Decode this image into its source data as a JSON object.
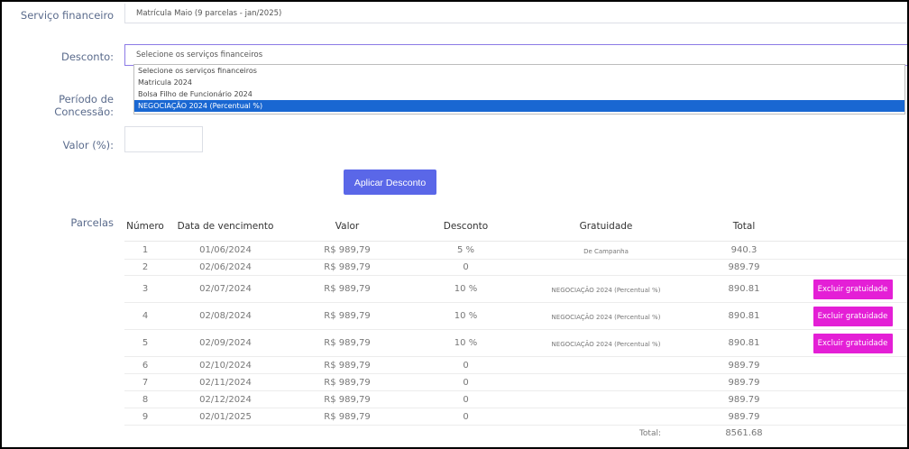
{
  "form": {
    "servico_label": "Serviço financeiro",
    "servico_value": "Matrícula Maio (9 parcelas - jan/2025)",
    "desconto_label": "Desconto:",
    "desconto_value": "Selecione os serviços financeiros",
    "periodo_label": "Período de Concessão:",
    "valor_label": "Valor (%):",
    "valor_value": "",
    "apply_label": "Aplicar Desconto"
  },
  "dropdown": {
    "options": [
      "Selecione os serviços financeiros",
      "Matricula 2024",
      "Bolsa Filho de Funcionário 2024",
      "NEGOCIAÇÃO 2024 (Percentual %)"
    ],
    "selected_index": 3
  },
  "parcelas": {
    "section_label": "Parcelas",
    "headers": [
      "Número",
      "Data de vencimento",
      "Valor",
      "Desconto",
      "Gratuidade",
      "Total"
    ],
    "rows": [
      {
        "numero": "1",
        "data": "01/06/2024",
        "valor": "R$ 989,79",
        "desconto": "5 %",
        "gratuidade": "De Campanha",
        "total": "940.3",
        "action": ""
      },
      {
        "numero": "2",
        "data": "02/06/2024",
        "valor": "R$ 989,79",
        "desconto": "0",
        "gratuidade": "",
        "total": "989.79",
        "action": ""
      },
      {
        "numero": "3",
        "data": "02/07/2024",
        "valor": "R$ 989,79",
        "desconto": "10 %",
        "gratuidade": "NEGOCIAÇÃO 2024 (Percentual %)",
        "total": "890.81",
        "action": "Excluir gratuidade"
      },
      {
        "numero": "4",
        "data": "02/08/2024",
        "valor": "R$ 989,79",
        "desconto": "10 %",
        "gratuidade": "NEGOCIAÇÃO 2024 (Percentual %)",
        "total": "890.81",
        "action": "Excluir gratuidade"
      },
      {
        "numero": "5",
        "data": "02/09/2024",
        "valor": "R$ 989,79",
        "desconto": "10 %",
        "gratuidade": "NEGOCIAÇÃO 2024 (Percentual %)",
        "total": "890.81",
        "action": "Excluir gratuidade"
      },
      {
        "numero": "6",
        "data": "02/10/2024",
        "valor": "R$ 989,79",
        "desconto": "0",
        "gratuidade": "",
        "total": "989.79",
        "action": ""
      },
      {
        "numero": "7",
        "data": "02/11/2024",
        "valor": "R$ 989,79",
        "desconto": "0",
        "gratuidade": "",
        "total": "989.79",
        "action": ""
      },
      {
        "numero": "8",
        "data": "02/12/2024",
        "valor": "R$ 989,79",
        "desconto": "0",
        "gratuidade": "",
        "total": "989.79",
        "action": ""
      },
      {
        "numero": "9",
        "data": "02/01/2025",
        "valor": "R$ 989,79",
        "desconto": "0",
        "gratuidade": "",
        "total": "989.79",
        "action": ""
      }
    ],
    "total_label": "Total:",
    "total_value": "8561.68"
  },
  "colors": {
    "apply_button": "#5a67e8",
    "exclude_button": "#e41fd6",
    "dropdown_selected": "#1967d2",
    "label_text": "#5a6b8c"
  }
}
